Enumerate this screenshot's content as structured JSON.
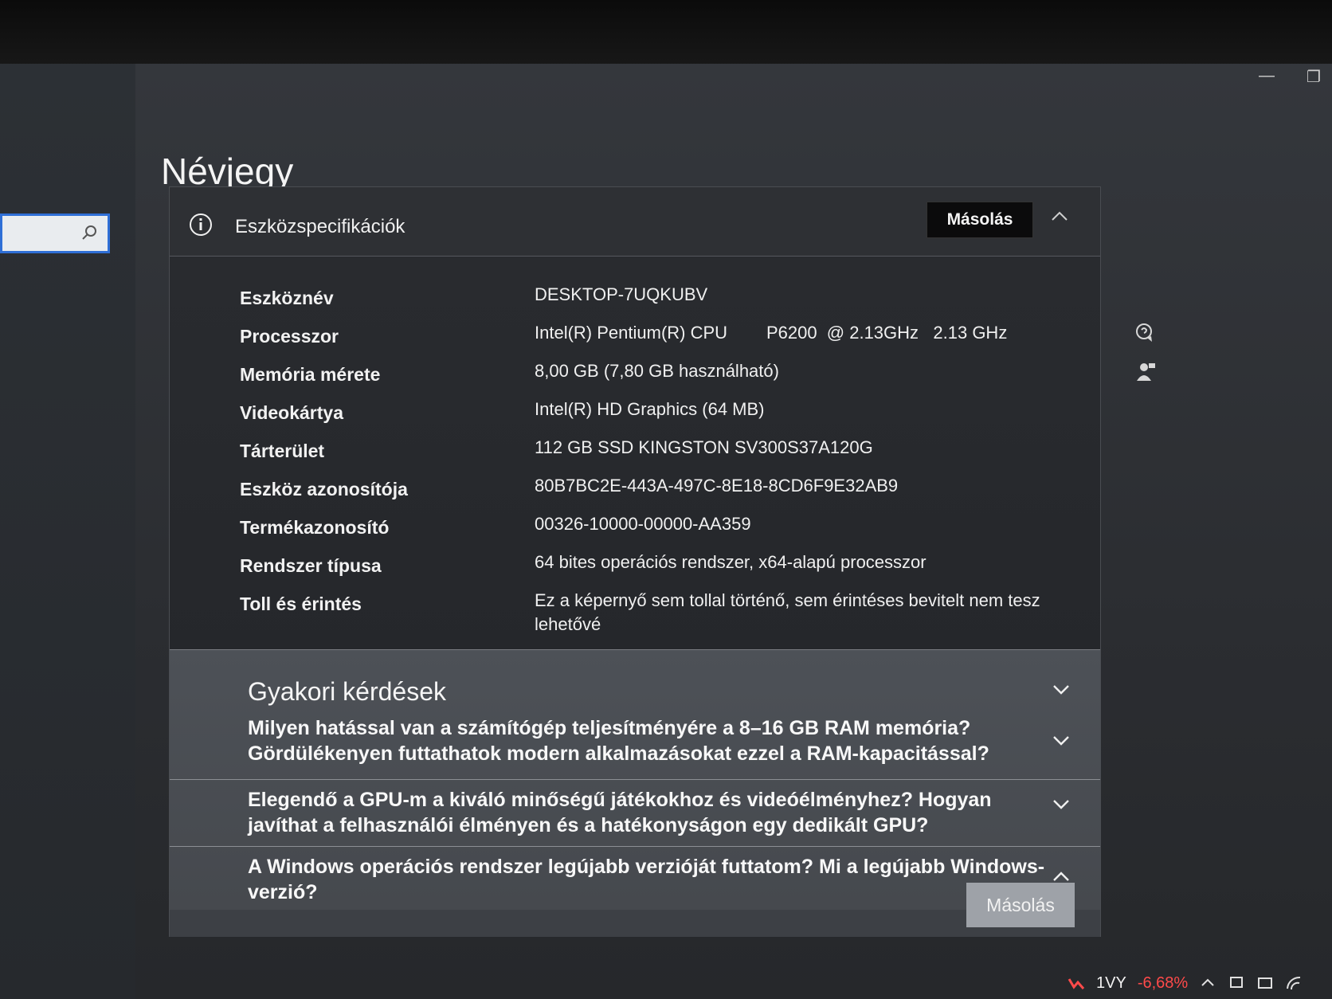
{
  "window": {
    "minimize_glyph": "—",
    "restore_glyph": "❐"
  },
  "search": {
    "icon": "search-icon"
  },
  "page": {
    "title": "Névjegy"
  },
  "device_specs": {
    "section_title": "Eszközspecifikációk",
    "copy_label": "Másolás",
    "rows": [
      {
        "label": "Eszköznév",
        "value": "DESKTOP-7UQKUBV"
      },
      {
        "label": "Processzor",
        "value": "Intel(R) Pentium(R) CPU        P6200  @ 2.13GHz   2.13 GHz"
      },
      {
        "label": "Memória mérete",
        "value": "8,00 GB (7,80 GB használható)"
      },
      {
        "label": "Videokártya",
        "value": "Intel(R) HD Graphics (64 MB)"
      },
      {
        "label": "Tárterület",
        "value": "112 GB SSD KINGSTON SV300S37A120G"
      },
      {
        "label": "Eszköz azonosítója",
        "value": "80B7BC2E-443A-497C-8E18-8CD6F9E32AB9"
      },
      {
        "label": "Termékazonosító",
        "value": "00326-10000-00000-AA359"
      },
      {
        "label": "Rendszer típusa",
        "value": "64 bites operációs rendszer, x64-alapú processzor"
      },
      {
        "label": "Toll és érintés",
        "value": "Ez a képernyő sem tollal történő, sem érintéses bevitelt nem tesz lehetővé"
      }
    ]
  },
  "faq": {
    "title": "Gyakori kérdések",
    "items": [
      {
        "text": "Milyen hatással van a számítógép teljesítményére a 8–16 GB RAM memória? Gördülékenyen futtathatok modern alkalmazásokat ezzel a RAM-kapacitással?"
      },
      {
        "text": "Elegendő a GPU-m a kiváló minőségű játékokhoz és videóélményhez? Hogyan javíthat a felhasználói élményen és a hatékonyságon egy dedikált GPU?"
      },
      {
        "text": "A Windows operációs rendszer legújabb verzióját futtatom? Mi a legújabb Windows-verzió?"
      }
    ],
    "copy_label": "Másolás"
  },
  "sidebar_right": {
    "actions": [
      {
        "icon": "help-chat-icon"
      },
      {
        "icon": "feedback-person-icon"
      }
    ]
  },
  "taskbar": {
    "stock_name": "1VY",
    "stock_change": "-6,68%",
    "colors": {
      "stock_down": "#ff4a4a"
    }
  }
}
